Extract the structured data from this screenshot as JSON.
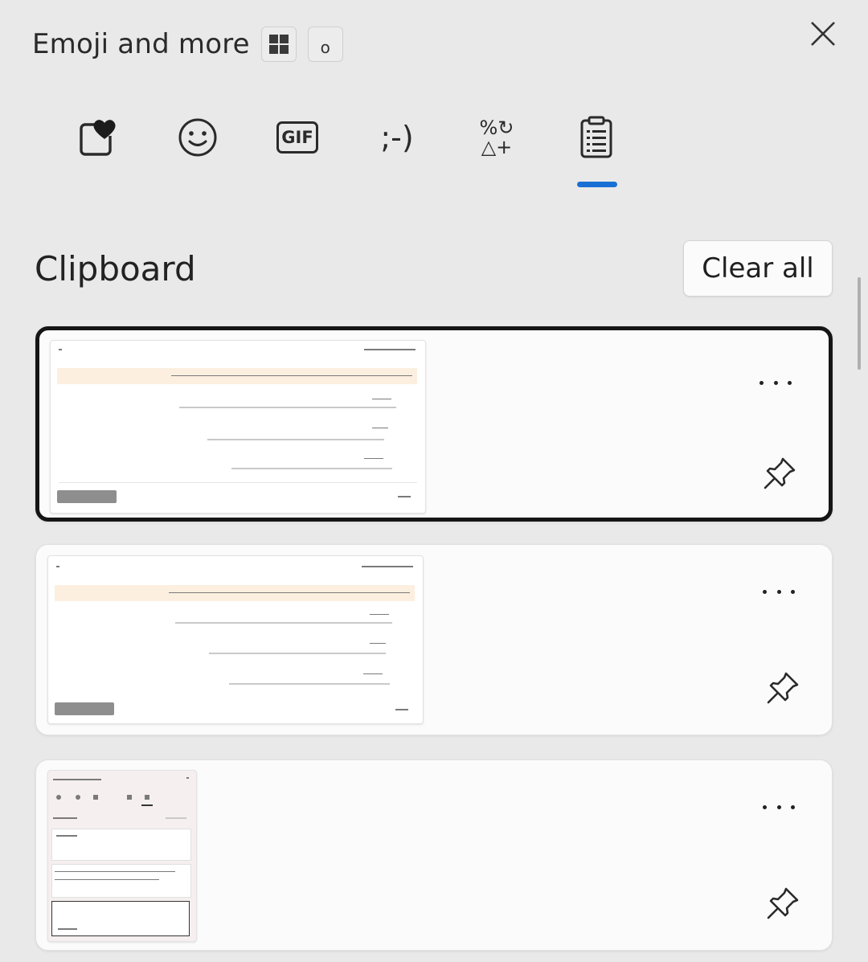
{
  "header": {
    "title": "Emoji and more",
    "view_toggle_icon": "grid-icon",
    "small_button_glyph": "o",
    "close_icon": "close-icon"
  },
  "tabs": [
    {
      "name": "favorites",
      "icon": "heart-square-icon",
      "active": false
    },
    {
      "name": "emoji",
      "icon": "smiley-icon",
      "active": false
    },
    {
      "name": "gif",
      "icon": "gif-icon",
      "label": "GIF",
      "active": false
    },
    {
      "name": "kaomoji",
      "icon": "kaomoji-icon",
      "label": ";-)",
      "active": false
    },
    {
      "name": "symbols",
      "icon": "symbols-icon",
      "label_top": "%↻",
      "label_bottom": "△+",
      "active": false
    },
    {
      "name": "clipboard",
      "icon": "clipboard-icon",
      "active": true
    }
  ],
  "accent_color": "#1a6fd4",
  "clipboard": {
    "title": "Clipboard",
    "clear_all_label": "Clear all",
    "items": [
      {
        "type": "screenshot",
        "selected": true,
        "more_icon": "more-icon",
        "pin_icon": "pin-icon"
      },
      {
        "type": "screenshot",
        "selected": false,
        "more_icon": "more-icon",
        "pin_icon": "pin-icon"
      },
      {
        "type": "screenshot",
        "selected": false,
        "more_icon": "more-icon",
        "pin_icon": "pin-icon"
      }
    ]
  }
}
